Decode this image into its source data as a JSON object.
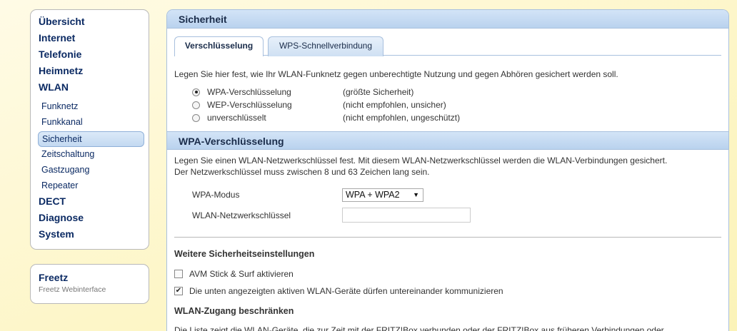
{
  "sidebar": {
    "items": [
      {
        "label": "Übersicht"
      },
      {
        "label": "Internet"
      },
      {
        "label": "Telefonie"
      },
      {
        "label": "Heimnetz"
      },
      {
        "label": "WLAN"
      }
    ],
    "wlan_sub": [
      {
        "label": "Funknetz"
      },
      {
        "label": "Funkkanal"
      },
      {
        "label": "Sicherheit",
        "active": true
      },
      {
        "label": "Zeitschaltung"
      },
      {
        "label": "Gastzugang"
      },
      {
        "label": "Repeater"
      }
    ],
    "items_after": [
      {
        "label": "DECT"
      },
      {
        "label": "Diagnose"
      },
      {
        "label": "System"
      }
    ]
  },
  "freetz": {
    "title": "Freetz",
    "subtitle": "Freetz Webinterface"
  },
  "main": {
    "title": "Sicherheit",
    "tabs": [
      {
        "label": "Verschlüsselung",
        "active": true
      },
      {
        "label": "WPS-Schnellverbindung",
        "active": false
      }
    ],
    "intro": "Legen Sie hier fest, wie Ihr WLAN-Funknetz gegen unberechtigte Nutzung und gegen Abhören gesichert werden soll.",
    "encryption_options": [
      {
        "label": "WPA-Verschlüsselung",
        "note": "(größte Sicherheit)",
        "checked": true
      },
      {
        "label": "WEP-Verschlüsselung",
        "note": "(nicht empfohlen, unsicher)",
        "checked": false
      },
      {
        "label": "unverschlüsselt",
        "note": "(nicht empfohlen, ungeschützt)",
        "checked": false
      }
    ]
  },
  "wpa": {
    "title": "WPA-Verschlüsselung",
    "desc_line1": "Legen Sie einen WLAN-Netzwerkschlüssel fest. Mit diesem WLAN-Netzwerkschlüssel werden die WLAN-Verbindungen gesichert.",
    "desc_line2": "Der Netzwerkschlüssel muss zwischen 8 und 63 Zeichen lang sein.",
    "mode_label": "WPA-Modus",
    "mode_value": "WPA + WPA2",
    "key_label": "WLAN-Netzwerkschlüssel",
    "key_value": ""
  },
  "further": {
    "title": "Weitere Sicherheitseinstellungen",
    "options": [
      {
        "label": "AVM Stick & Surf aktivieren",
        "checked": false
      },
      {
        "label": "Die unten angezeigten aktiven WLAN-Geräte dürfen untereinander kommunizieren",
        "checked": true
      }
    ]
  },
  "restrict": {
    "title": "WLAN-Zugang beschränken",
    "text": "Die Liste zeigt die WLAN-Geräte, die zur Zeit mit der FRITZ!Box verbunden oder der FRITZ!Box aus früheren Verbindungen oder"
  }
}
